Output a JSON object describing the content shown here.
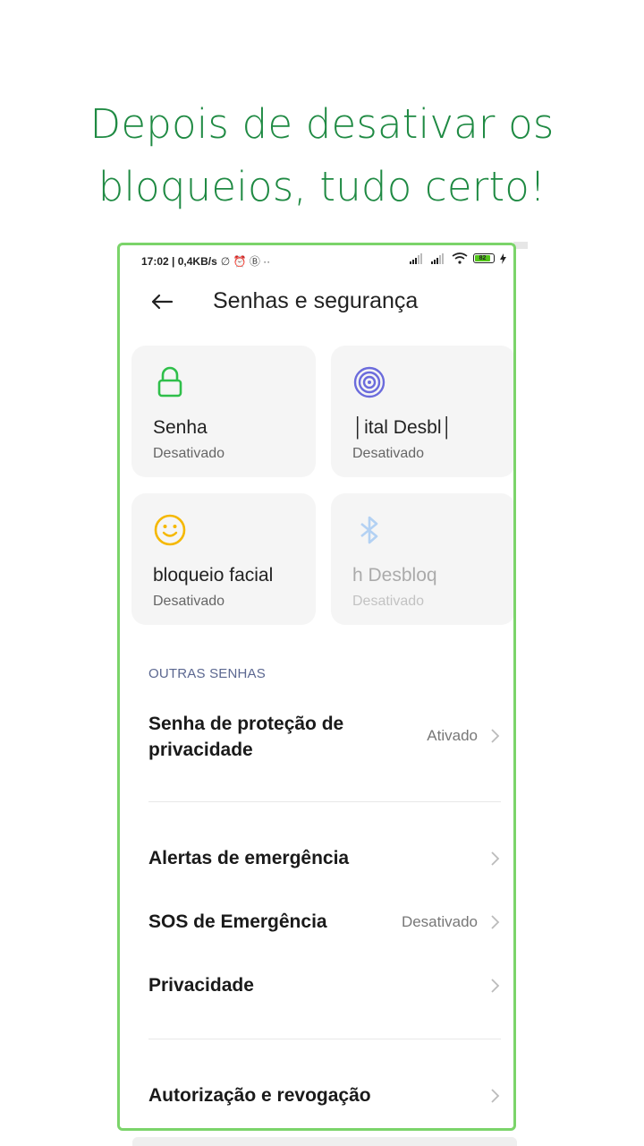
{
  "headline": {
    "line1": "Depois de desativar os",
    "line2": "bloqueios, tudo certo!"
  },
  "statusbar": {
    "time_speed": "17:02 | 0,4KB/s",
    "extra_icons": "∅ ⏰ Ⓑ ··",
    "signal": "..││ ..││",
    "battery": "82"
  },
  "header": {
    "title": "Senhas e segurança"
  },
  "cards": [
    {
      "name": "Senha",
      "status": "Desativado",
      "icon": "lock-icon",
      "color": "#2fbf4a"
    },
    {
      "name": "│ital      Desbl│",
      "status": "Desativado",
      "icon": "fingerprint-icon",
      "color": "#6b6bdc"
    },
    {
      "name": "bloqueio facial",
      "status": "Desativado",
      "icon": "smiley-icon",
      "color": "#f5b800"
    },
    {
      "name": "h      Desbloq",
      "status": "Desativado",
      "icon": "bluetooth-icon",
      "color": "#3a8ff0"
    }
  ],
  "section": {
    "title": "OUTRAS SENHAS"
  },
  "rows": [
    {
      "label_line1": "Senha de proteção de",
      "label_line2": "privacidade",
      "value": "Ativado"
    },
    {
      "label": "Alertas de emergência",
      "value": ""
    },
    {
      "label": "SOS de Emergência",
      "value": "Desativado"
    },
    {
      "label": "Privacidade",
      "value": ""
    },
    {
      "label": "Autorização e revogação",
      "value": ""
    }
  ],
  "colors": {
    "headline": "#1f8a43",
    "frame": "#7bd46a",
    "card_bg": "#f5f5f5"
  }
}
